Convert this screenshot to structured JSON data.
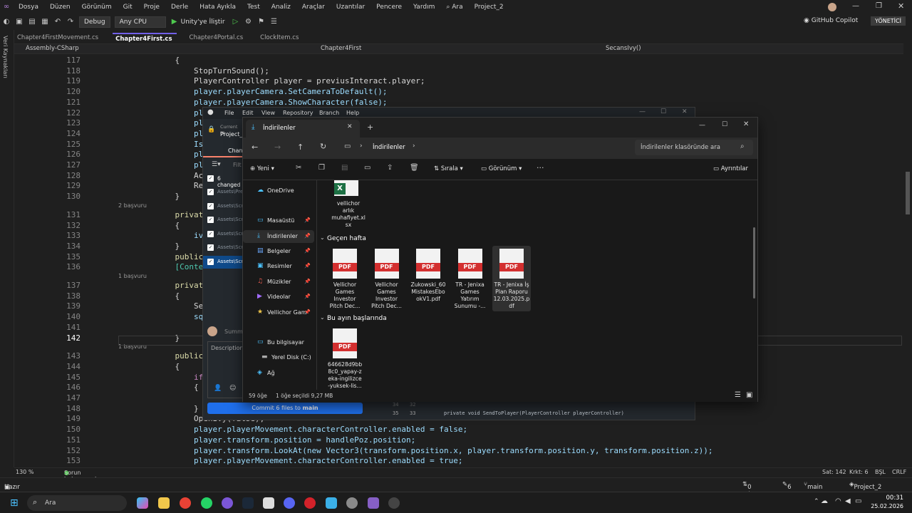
{
  "vs": {
    "menu": [
      "Dosya",
      "Düzen",
      "Görünüm",
      "Git",
      "Proje",
      "Derle",
      "Hata Ayıkla",
      "Test",
      "Analiz",
      "Araçlar",
      "Uzantılar",
      "Pencere",
      "Yardım"
    ],
    "search_label": "Ara",
    "solution_name": "Project_2",
    "config": "Debug",
    "platform": "Any CPU",
    "run_label": "Unity'ye İliştir",
    "copilot": "GitHub Copilot",
    "admin": "YÖNETİCİ",
    "side_label": "Veri Kaynakları",
    "tabs": [
      "Chapter4FirstMovement.cs",
      "Chapter4First.cs",
      "Chapter4Portal.cs",
      "ClockItem.cs"
    ],
    "nav": {
      "project": "Assembly-CSharp",
      "class": "Chapter4First",
      "member": "SecansIvy()"
    },
    "status": {
      "zoom": "130 %",
      "issues": "Sorun bulunamadı",
      "line": "Sat: 142",
      "col": "Krkt: 6",
      "ws": "BŞL",
      "eol": "CRLF"
    },
    "bottom": {
      "ready": "Hazır",
      "sync": "0 / 0",
      "changes": "6",
      "branch": "main",
      "repo": "Project_2"
    }
  },
  "code": [
    {
      "n": "117",
      "t": "            {",
      "r": ""
    },
    {
      "n": "118",
      "t": "                StopTurnSound();",
      "r": ""
    },
    {
      "n": "119",
      "t": "                PlayerController player = previusInteract.player;",
      "r": ""
    },
    {
      "n": "120",
      "t": "                player.playerCamera.SetCameraToDefault();",
      "r": ""
    },
    {
      "n": "121",
      "t": "                player.playerCamera.ShowCharacter(false);",
      "r": ""
    },
    {
      "n": "122",
      "t": "                player.playerA",
      "r": ""
    },
    {
      "n": "123",
      "t": "                player.SetDefa",
      "r": ""
    },
    {
      "n": "124",
      "t": "                player.rig.wei",
      "r": ""
    },
    {
      "n": "125",
      "t": "                IsInteract = f",
      "r": ""
    },
    {
      "n": "126",
      "t": "                player.Interac",
      "r": ""
    },
    {
      "n": "127",
      "t": "                player.Interac",
      "r": ""
    },
    {
      "n": "128",
      "t": "                ActionTimer.St",
      "r": ""
    },
    {
      "n": "129",
      "t": "                ResetThisRpc()",
      "r": ""
    },
    {
      "n": "130",
      "t": "            }",
      "r": ""
    },
    {
      "n": "131",
      "t": "            private void OpenI",
      "r": "2 başvuru"
    },
    {
      "n": "132",
      "t": "            {",
      "r": ""
    },
    {
      "n": "133",
      "t": "                ivyMesh.materi",
      "r": ""
    },
    {
      "n": "134",
      "t": "            }",
      "r": ""
    },
    {
      "n": "135",
      "t": "            public float sekan",
      "r": ""
    },
    {
      "n": "136",
      "t": "            [ContextMenu(\"Seka",
      "r": ""
    },
    {
      "n": "137",
      "t": "            private void Secan",
      "r": "1 başvuru"
    },
    {
      "n": "138",
      "t": "            {",
      "r": ""
    },
    {
      "n": "139",
      "t": "                Sequence sq =",
      "r": ""
    },
    {
      "n": "140",
      "t": "                sq.Append(ivyM",
      "r": ""
    },
    {
      "n": "141",
      "t": "                        .Append(",
      "r": ""
    },
    {
      "n": "142",
      "t": "            }",
      "r": ""
    },
    {
      "n": "143",
      "t": "            public void StartA",
      "r": "1 başvuru"
    },
    {
      "n": "144",
      "t": "            {",
      "r": ""
    },
    {
      "n": "145",
      "t": "                if (!player.Is",
      "r": ""
    },
    {
      "n": "146",
      "t": "                {",
      "r": ""
    },
    {
      "n": "147",
      "t": "                    return;",
      "r": ""
    },
    {
      "n": "148",
      "t": "                }",
      "r": ""
    },
    {
      "n": "149",
      "t": "                OpenIvy(false);",
      "r": ""
    },
    {
      "n": "150",
      "t": "                player.playerMovement.characterController.enabled = false;",
      "r": ""
    },
    {
      "n": "151",
      "t": "                player.transform.position = handlePoz.position;",
      "r": ""
    },
    {
      "n": "152",
      "t": "                player.transform.LookAt(new Vector3(transform.position.x, player.transform.position.y, transform.position.z));",
      "r": ""
    },
    {
      "n": "153",
      "t": "                player.playerMovement.characterController.enabled = true;",
      "r": ""
    }
  ],
  "github": {
    "menu": [
      "File",
      "Edit",
      "View",
      "Repository",
      "Branch",
      "Help"
    ],
    "current_repo_label": "Current re",
    "repo": "Project_2",
    "changes_tab": "Chan",
    "filter_placeholder": "Filt",
    "changed_count": "6 changed",
    "files": [
      "Assets\\Pre",
      "Assets\\Scr",
      "Assets\\Scr",
      "Assets\\Scr",
      "Assets\\Scr",
      "Assets\\Scr"
    ],
    "summary_placeholder": "Summ",
    "description_placeholder": "Description",
    "commit_prefix": "Commit 6 files to ",
    "commit_branch": "main",
    "diff": {
      "l1a": "34",
      "l1b": "32",
      "l2a": "35",
      "l2b": "33",
      "code": "private void SendToPlayer(PlayerController playerController)"
    }
  },
  "explorer": {
    "tab_title": "İndirilenler",
    "breadcrumb": "İndirilenler",
    "search_placeholder": "İndirilenler klasöründe ara",
    "new_label": "Yeni",
    "sort_label": "Sırala",
    "view_label": "Görünüm",
    "details_label": "Ayrıntılar",
    "sidebar": [
      "OneDrive",
      "Masaüstü",
      "İndirilenler",
      "Belgeler",
      "Resimler",
      "Müzikler",
      "Videolar",
      "Vellichor Gam",
      "Bu bilgisayar",
      "Yerel Disk (C:)",
      "Ağ"
    ],
    "groups": [
      "Geçen hafta",
      "Bu ayın başlarında"
    ],
    "xlsx_name": "vellichor\narlık\nmuhafiyet.xl\nsx",
    "pdfs_last_week": [
      "Vellichor\nGames\nInvestor\nPitch Dec...",
      "Vellichor\nGames\nInvestor\nPitch Dec...",
      "Zukowski_60\nMistakesEbo\nokV1.pdf",
      "TR - Jenixa\nGames\nYatırım\nSunumu -...",
      "TR - Jenixa İş\nPlan Raporu\n12.03.2025.p\ndf"
    ],
    "pdfs_this_month": [
      "646628d9bb\n8c0_yapay-z\neka-ingilizce\n-yuksek-lis..."
    ],
    "pdf_badge": "PDF",
    "status": {
      "count": "59 öğe",
      "selected": "1 öğe seçildi  9,27 MB"
    }
  },
  "taskbar": {
    "search": "Ara",
    "time": "00:31",
    "date": "25.02.2026"
  }
}
